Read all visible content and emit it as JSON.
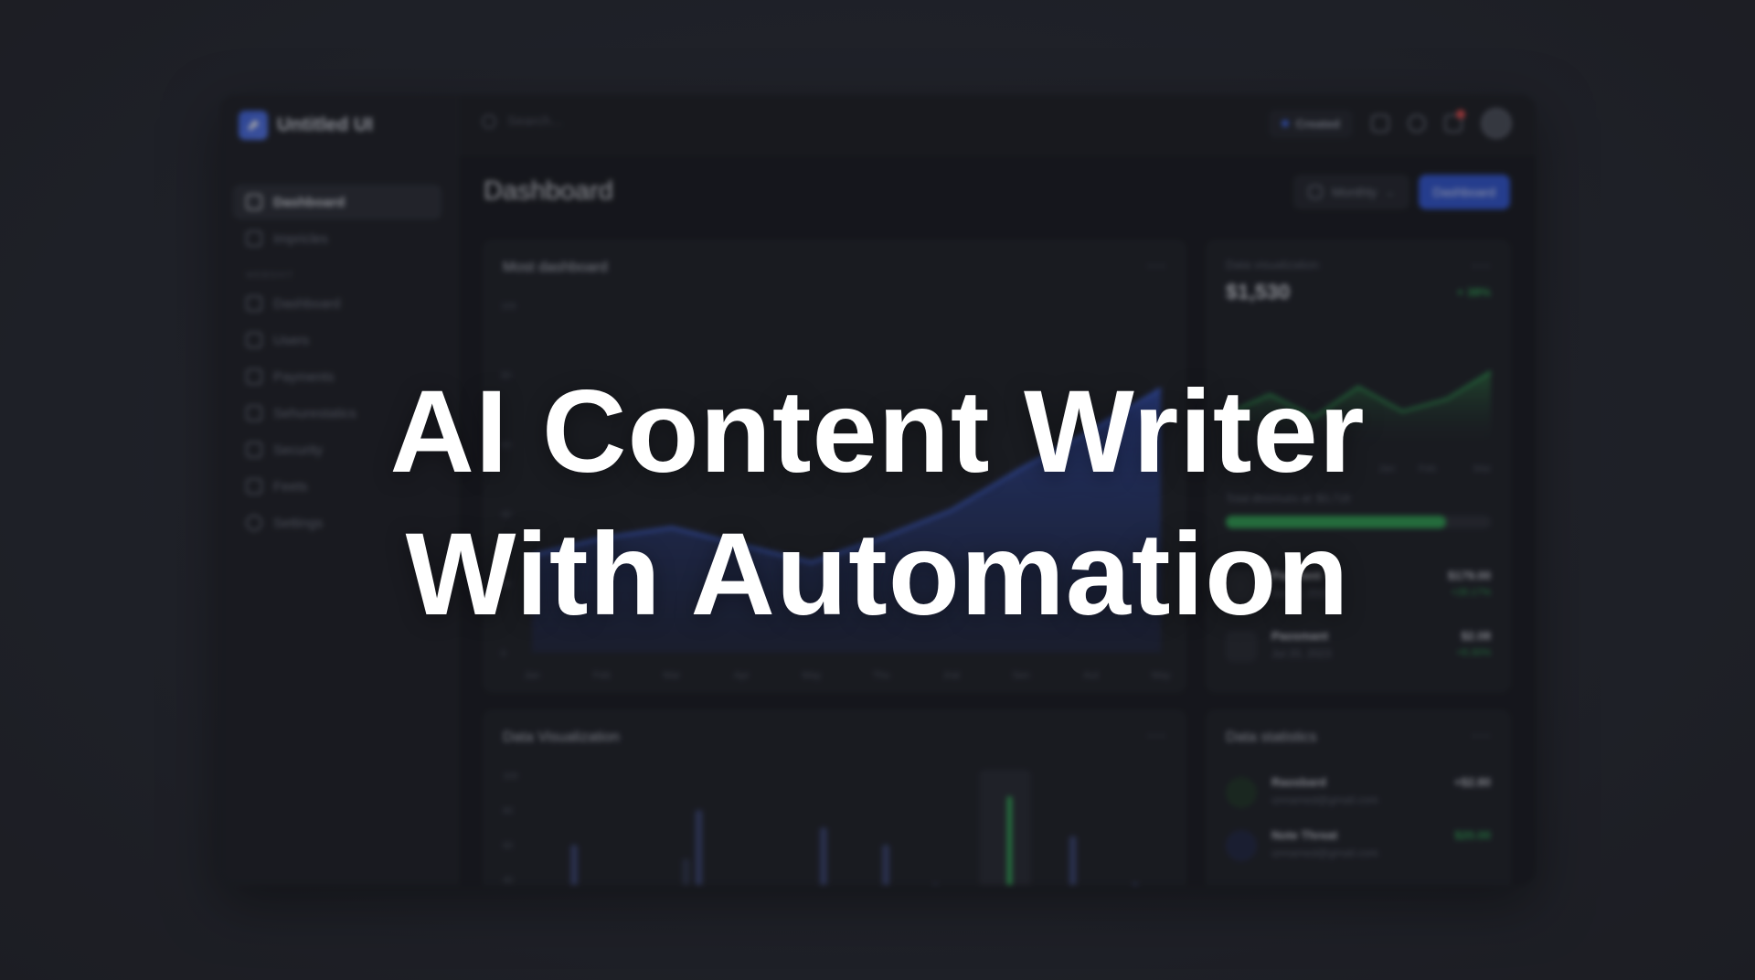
{
  "app": {
    "brand": "Untitled UI"
  },
  "sidebar": {
    "items": [
      {
        "label": "Dashboard",
        "active": true,
        "icon": "home-icon"
      },
      {
        "label": "Impricles",
        "active": false,
        "icon": "check-square-icon"
      }
    ],
    "section_label": "WEBSHIT",
    "section_items": [
      {
        "label": "Dashboard",
        "icon": "grid-icon"
      },
      {
        "label": "Users",
        "icon": "users-icon"
      },
      {
        "label": "Payments",
        "icon": "check-square-icon"
      },
      {
        "label": "Sehurestatics",
        "icon": "diamond-icon"
      },
      {
        "label": "Security",
        "icon": "folder-icon"
      },
      {
        "label": "Feets",
        "icon": "trash-icon"
      },
      {
        "label": "Settings",
        "icon": "gear-icon"
      }
    ]
  },
  "topbar": {
    "search_placeholder": "Search...",
    "created_label": "Created"
  },
  "main": {
    "page_title": "Dashboard",
    "period_label": "Monthly",
    "primary_button": "Dashboard"
  },
  "cards": {
    "main_chart": {
      "title": "Most dashboard"
    },
    "data_vis_card": {
      "subtitle": "Data visualization",
      "value": "$1,530",
      "change": "+ 38%",
      "progress_label": "Total dissmues at: $3,718",
      "progress_fraction": 0.83,
      "rows": [
        {
          "title": "Payment",
          "sub": "Jul 20, 2023",
          "amount": "$179.00",
          "change": "+28.17%"
        },
        {
          "title": "Paosmant",
          "sub": "Jul 20, 2023",
          "amount": "$2.08",
          "change": "+8.30%"
        }
      ]
    },
    "bar_chart": {
      "title": "Data Visualization"
    },
    "stats": {
      "title": "Data statistics",
      "rows": [
        {
          "title": "Raosbard",
          "sub": "unnamed@gmail.com",
          "amount": "+$2.80"
        },
        {
          "title": "Note Threat",
          "sub": "unnamed@gmail.com",
          "amount": "$20.00"
        }
      ]
    }
  },
  "headline": {
    "line1": "AI Content Writer",
    "line2": "With Automation"
  },
  "colors": {
    "accent": "#3056d3",
    "positive": "#2ea051",
    "background": "#262932"
  },
  "chart_data": [
    {
      "type": "area",
      "title": "Most dashboard",
      "x": [
        "Jan",
        "Feb",
        "Mar",
        "Apr",
        "May",
        "Thu",
        "Jrat",
        "Sen",
        "Aut",
        "May"
      ],
      "y_ticks": [
        0,
        20,
        40,
        60,
        80,
        100
      ],
      "values": [
        28,
        33,
        36,
        31,
        26,
        33,
        41,
        53,
        64,
        76
      ],
      "ylim": [
        0,
        100
      ]
    },
    {
      "type": "area",
      "title": "Data visualization",
      "x": [
        "Jan",
        "Feb",
        "Mar"
      ],
      "values": [
        42,
        55,
        40,
        60,
        44,
        52,
        70
      ],
      "ylim": [
        0,
        100
      ]
    },
    {
      "type": "bar",
      "title": "Data Visualization",
      "y_ticks": [
        100,
        80,
        60,
        40
      ],
      "series": [
        {
          "values": [
            28,
            22,
            52,
            32,
            28,
            24,
            38,
            36,
            30,
            22
          ]
        },
        {
          "values": [
            60,
            12,
            80,
            20,
            70,
            60,
            12,
            88,
            65,
            38
          ]
        }
      ],
      "highlight_index": 7,
      "ylim": [
        0,
        100
      ]
    }
  ]
}
